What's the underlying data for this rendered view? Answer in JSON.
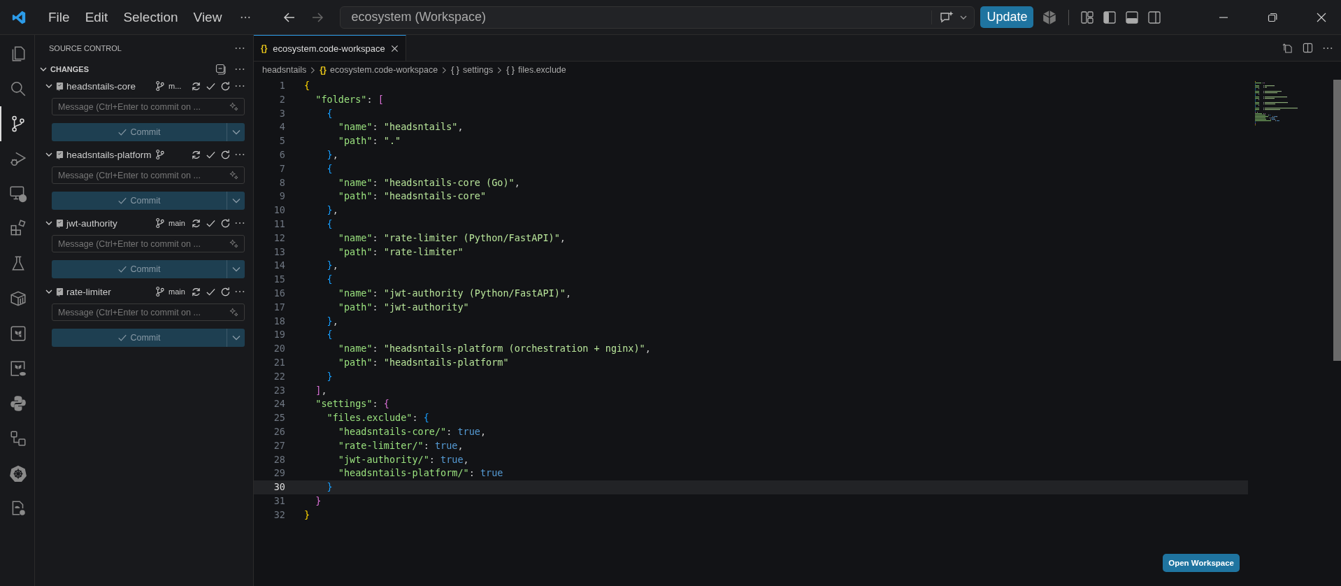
{
  "title_bar": {
    "menu": [
      "File",
      "Edit",
      "Selection",
      "View"
    ],
    "nav": [
      {
        "kind": "back",
        "disabled": false
      },
      {
        "kind": "forward",
        "disabled": true
      }
    ],
    "search": {
      "value": "ecosystem (Workspace)"
    },
    "update_button": "Update"
  },
  "activity_bar": [
    {
      "kind": "files",
      "selected": false
    },
    {
      "kind": "search",
      "selected": false
    },
    {
      "kind": "source-control",
      "selected": true
    },
    {
      "kind": "run-debug",
      "selected": false
    },
    {
      "kind": "remote",
      "selected": false
    },
    {
      "kind": "extensions",
      "selected": false
    },
    {
      "kind": "testing",
      "selected": false
    },
    {
      "kind": "container",
      "selected": false
    },
    {
      "kind": "terraform",
      "selected": false
    },
    {
      "kind": "terraform-cloud",
      "selected": false
    },
    {
      "kind": "python",
      "selected": false
    },
    {
      "kind": "flow",
      "selected": false
    },
    {
      "kind": "kubernetes",
      "selected": false
    },
    {
      "kind": "file-gear",
      "selected": false
    }
  ],
  "sidebar": {
    "title": "SOURCE CONTROL",
    "section": {
      "label": "CHANGES",
      "expanded": true
    },
    "repos": [
      {
        "name": "headsntails-core",
        "branch": "m...",
        "expanded": true,
        "placeholder": "Message (Ctrl+Enter to commit on ...",
        "commit": "Commit"
      },
      {
        "name": "headsntails-platform",
        "expanded": true,
        "placeholder": "Message (Ctrl+Enter to commit on ...",
        "commit": "Commit"
      },
      {
        "name": "jwt-authority",
        "branch": "main",
        "expanded": true,
        "placeholder": "Message (Ctrl+Enter to commit on ...",
        "commit": "Commit"
      },
      {
        "name": "rate-limiter",
        "branch": "main",
        "expanded": true,
        "placeholder": "Message (Ctrl+Enter to commit on ...",
        "commit": "Commit"
      }
    ]
  },
  "editor": {
    "tabs": [
      {
        "icon": "{}",
        "label": "ecosystem.code-workspace",
        "selected": true
      }
    ],
    "breadcrumbs": [
      {
        "label": "headsntails"
      },
      {
        "icon": "{}",
        "label": "ecosystem.code-workspace"
      },
      {
        "icon": "{ }",
        "label": "settings"
      },
      {
        "icon": "{ }",
        "label": "files.exclude"
      }
    ],
    "lines": [
      {
        "num": "1",
        "current": false,
        "tokens": [
          {
            "text": "{",
            "kind": "bracket1"
          }
        ]
      },
      {
        "num": "2",
        "current": false,
        "tokens": [
          {
            "text": "  \"folders\"",
            "kind": "key"
          },
          {
            "text": ": ",
            "kind": "punct"
          },
          {
            "text": "[",
            "kind": "bracket2"
          }
        ]
      },
      {
        "num": "3",
        "current": false,
        "tokens": [
          {
            "text": "    {",
            "kind": "bracket3"
          }
        ]
      },
      {
        "num": "4",
        "current": false,
        "tokens": [
          {
            "text": "      \"name\"",
            "kind": "key"
          },
          {
            "text": ": ",
            "kind": "punct"
          },
          {
            "text": "\"headsntails\"",
            "kind": "string"
          },
          {
            "text": ",",
            "kind": "punct"
          }
        ]
      },
      {
        "num": "5",
        "current": false,
        "tokens": [
          {
            "text": "      \"path\"",
            "kind": "key"
          },
          {
            "text": ": ",
            "kind": "punct"
          },
          {
            "text": "\".\"",
            "kind": "string"
          }
        ]
      },
      {
        "num": "6",
        "current": false,
        "tokens": [
          {
            "text": "    }",
            "kind": "bracket3"
          },
          {
            "text": ",",
            "kind": "punct"
          }
        ]
      },
      {
        "num": "7",
        "current": false,
        "tokens": [
          {
            "text": "    {",
            "kind": "bracket3"
          }
        ]
      },
      {
        "num": "8",
        "current": false,
        "tokens": [
          {
            "text": "      \"name\"",
            "kind": "key"
          },
          {
            "text": ": ",
            "kind": "punct"
          },
          {
            "text": "\"headsntails-core (Go)\"",
            "kind": "string"
          },
          {
            "text": ",",
            "kind": "punct"
          }
        ]
      },
      {
        "num": "9",
        "current": false,
        "tokens": [
          {
            "text": "      \"path\"",
            "kind": "key"
          },
          {
            "text": ": ",
            "kind": "punct"
          },
          {
            "text": "\"headsntails-core\"",
            "kind": "string"
          }
        ]
      },
      {
        "num": "10",
        "current": false,
        "tokens": [
          {
            "text": "    }",
            "kind": "bracket3"
          },
          {
            "text": ",",
            "kind": "punct"
          }
        ]
      },
      {
        "num": "11",
        "current": false,
        "tokens": [
          {
            "text": "    {",
            "kind": "bracket3"
          }
        ]
      },
      {
        "num": "12",
        "current": false,
        "tokens": [
          {
            "text": "      \"name\"",
            "kind": "key"
          },
          {
            "text": ": ",
            "kind": "punct"
          },
          {
            "text": "\"rate-limiter (Python/FastAPI)\"",
            "kind": "string"
          },
          {
            "text": ",",
            "kind": "punct"
          }
        ]
      },
      {
        "num": "13",
        "current": false,
        "tokens": [
          {
            "text": "      \"path\"",
            "kind": "key"
          },
          {
            "text": ": ",
            "kind": "punct"
          },
          {
            "text": "\"rate-limiter\"",
            "kind": "string"
          }
        ]
      },
      {
        "num": "14",
        "current": false,
        "tokens": [
          {
            "text": "    }",
            "kind": "bracket3"
          },
          {
            "text": ",",
            "kind": "punct"
          }
        ]
      },
      {
        "num": "15",
        "current": false,
        "tokens": [
          {
            "text": "    {",
            "kind": "bracket3"
          }
        ]
      },
      {
        "num": "16",
        "current": false,
        "tokens": [
          {
            "text": "      \"name\"",
            "kind": "key"
          },
          {
            "text": ": ",
            "kind": "punct"
          },
          {
            "text": "\"jwt-authority (Python/FastAPI)\"",
            "kind": "string"
          },
          {
            "text": ",",
            "kind": "punct"
          }
        ]
      },
      {
        "num": "17",
        "current": false,
        "tokens": [
          {
            "text": "      \"path\"",
            "kind": "key"
          },
          {
            "text": ": ",
            "kind": "punct"
          },
          {
            "text": "\"jwt-authority\"",
            "kind": "string"
          }
        ]
      },
      {
        "num": "18",
        "current": false,
        "tokens": [
          {
            "text": "    }",
            "kind": "bracket3"
          },
          {
            "text": ",",
            "kind": "punct"
          }
        ]
      },
      {
        "num": "19",
        "current": false,
        "tokens": [
          {
            "text": "    {",
            "kind": "bracket3"
          }
        ]
      },
      {
        "num": "20",
        "current": false,
        "tokens": [
          {
            "text": "      \"name\"",
            "kind": "key"
          },
          {
            "text": ": ",
            "kind": "punct"
          },
          {
            "text": "\"headsntails-platform (orchestration + nginx)\"",
            "kind": "string"
          },
          {
            "text": ",",
            "kind": "punct"
          }
        ]
      },
      {
        "num": "21",
        "current": false,
        "tokens": [
          {
            "text": "      \"path\"",
            "kind": "key"
          },
          {
            "text": ": ",
            "kind": "punct"
          },
          {
            "text": "\"headsntails-platform\"",
            "kind": "string"
          }
        ]
      },
      {
        "num": "22",
        "current": false,
        "tokens": [
          {
            "text": "    }",
            "kind": "bracket3"
          }
        ]
      },
      {
        "num": "23",
        "current": false,
        "tokens": [
          {
            "text": "  ]",
            "kind": "bracket2"
          },
          {
            "text": ",",
            "kind": "punct"
          }
        ]
      },
      {
        "num": "24",
        "current": false,
        "tokens": [
          {
            "text": "  \"settings\"",
            "kind": "key"
          },
          {
            "text": ": ",
            "kind": "punct"
          },
          {
            "text": "{",
            "kind": "bracket2"
          }
        ]
      },
      {
        "num": "25",
        "current": false,
        "tokens": [
          {
            "text": "    \"files.exclude\"",
            "kind": "key"
          },
          {
            "text": ": ",
            "kind": "punct"
          },
          {
            "text": "{",
            "kind": "bracket3"
          }
        ]
      },
      {
        "num": "26",
        "current": false,
        "tokens": [
          {
            "text": "      \"headsntails-core/\"",
            "kind": "key"
          },
          {
            "text": ": ",
            "kind": "punct"
          },
          {
            "text": "true",
            "kind": "bool"
          },
          {
            "text": ",",
            "kind": "punct"
          }
        ]
      },
      {
        "num": "27",
        "current": false,
        "tokens": [
          {
            "text": "      \"rate-limiter/\"",
            "kind": "key"
          },
          {
            "text": ": ",
            "kind": "punct"
          },
          {
            "text": "true",
            "kind": "bool"
          },
          {
            "text": ",",
            "kind": "punct"
          }
        ]
      },
      {
        "num": "28",
        "current": false,
        "tokens": [
          {
            "text": "      \"jwt-authority/\"",
            "kind": "key"
          },
          {
            "text": ": ",
            "kind": "punct"
          },
          {
            "text": "true",
            "kind": "bool"
          },
          {
            "text": ",",
            "kind": "punct"
          }
        ]
      },
      {
        "num": "29",
        "current": false,
        "tokens": [
          {
            "text": "      \"headsntails-platform/\"",
            "kind": "key"
          },
          {
            "text": ": ",
            "kind": "punct"
          },
          {
            "text": "true",
            "kind": "bool"
          }
        ]
      },
      {
        "num": "30",
        "current": true,
        "tokens": [
          {
            "text": "    }",
            "kind": "bracket3"
          }
        ]
      },
      {
        "num": "31",
        "current": false,
        "tokens": [
          {
            "text": "  }",
            "kind": "bracket2"
          }
        ]
      },
      {
        "num": "32",
        "current": false,
        "tokens": [
          {
            "text": "}",
            "kind": "bracket1"
          }
        ]
      }
    ],
    "open_workspace_button": "Open Workspace"
  }
}
